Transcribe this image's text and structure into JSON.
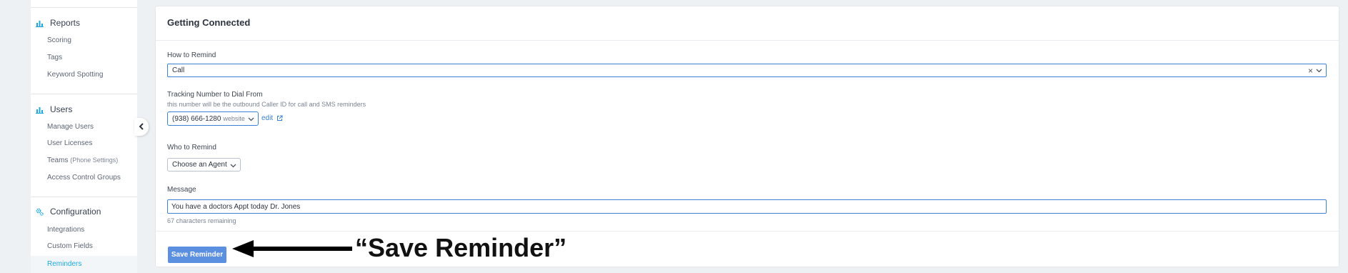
{
  "sidebar": {
    "sections": [
      {
        "title": "Reports",
        "icon": "bar-chart-icon",
        "items": [
          {
            "label": "Scoring"
          },
          {
            "label": "Tags"
          },
          {
            "label": "Keyword Spotting"
          }
        ]
      },
      {
        "title": "Users",
        "icon": "bar-chart-icon",
        "items": [
          {
            "label": "Manage Users"
          },
          {
            "label": "User Licenses"
          },
          {
            "label": "Teams",
            "sub": "(Phone Settings)"
          },
          {
            "label": "Access Control Groups"
          }
        ]
      },
      {
        "title": "Configuration",
        "icon": "gears-icon",
        "items": [
          {
            "label": "Integrations"
          },
          {
            "label": "Custom Fields"
          },
          {
            "label": "Reminders",
            "active": true
          }
        ]
      }
    ]
  },
  "colors": {
    "accent": "#1ea9e1",
    "primary": "#5b8fe0",
    "focus_border": "#3b82d6"
  },
  "main": {
    "title": "Getting Connected",
    "how_to_remind": {
      "label": "How to Remind",
      "value": "Call",
      "clear_symbol": "×"
    },
    "tracking": {
      "label": "Tracking Number to Dial From",
      "help": "this number will be the outbound Caller ID for call and SMS reminders",
      "number": "(938) 666-1280",
      "tag": "website",
      "edit_label": "edit"
    },
    "who_to_remind": {
      "label": "Who to Remind",
      "value": "Choose an Agent"
    },
    "message": {
      "label": "Message",
      "value": "You have a doctors Appt today Dr. Jones",
      "remaining": "67 characters remaining"
    },
    "save_label": "Save Reminder"
  },
  "annotation": {
    "text": "“Save Reminder”"
  }
}
